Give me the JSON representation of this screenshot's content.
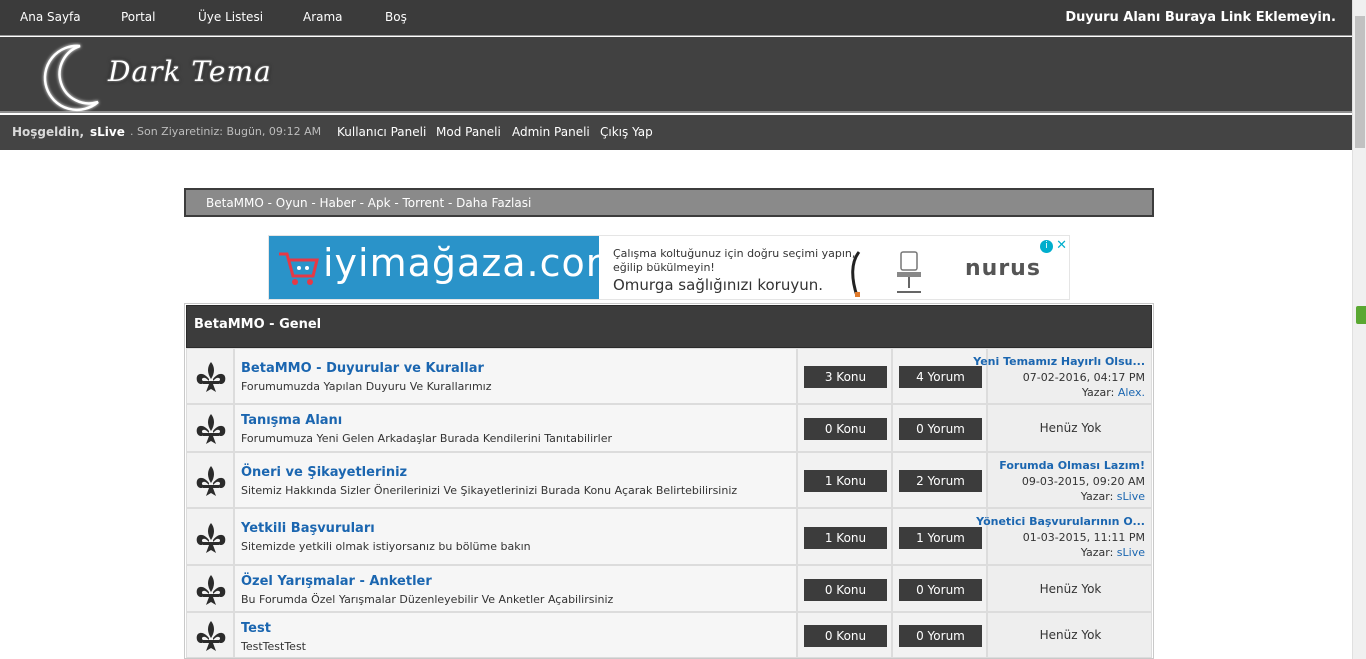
{
  "topnav": {
    "items": [
      "Ana Sayfa",
      "Portal",
      "Üye Listesi",
      "Arama",
      "Boş"
    ],
    "announcement": "Duyuru Alanı Buraya Link Eklemeyin."
  },
  "header": {
    "logo_text": "Dark Tema"
  },
  "userbar": {
    "greeting": "Hoşgeldin,",
    "username": "sLive",
    "last_visit": ". Son Ziyaretiniz: Bugün, 09:12 AM",
    "links": [
      "Kullanıcı Paneli",
      "Mod Paneli",
      "Admin Paneli",
      "Çıkış Yap"
    ]
  },
  "breadcrumb": "BetaMMO - Oyun - Haber - Apk - Torrent - Daha Fazlasi",
  "ad": {
    "brand": "iyimağaza.com",
    "line1": "Çalışma koltuğunuz için doğru seçimi yapın,",
    "line2": "eğilip bükülmeyin!",
    "line3": "Omurga sağlığınızı koruyun.",
    "sponsor": "nurus",
    "info_icon": "i",
    "close_icon": "✕"
  },
  "category": {
    "title": "BetaMMO - Genel"
  },
  "forums": [
    {
      "title": "BetaMMO - Duyurular ve Kurallar",
      "desc": "Forumumuzda Yapılan Duyuru Ve Kurallarımız",
      "topics": "3 Konu",
      "posts": "4 Yorum",
      "last": {
        "title": "Yeni Temamız Hayırlı Olsu...",
        "date": "07-02-2016, 04:17 PM",
        "author_label": "Yazar:",
        "author": "Alex."
      }
    },
    {
      "title": "Tanışma Alanı",
      "desc": "Forumumuza Yeni Gelen Arkadaşlar Burada Kendilerini Tanıtabilirler",
      "topics": "0 Konu",
      "posts": "0 Yorum",
      "last": {
        "none": "Henüz Yok"
      }
    },
    {
      "title": "Öneri ve Şikayetleriniz",
      "desc": "Sitemiz Hakkında Sizler Önerilerinizi Ve Şikayetlerinizi Burada Konu Açarak Belirtebilirsiniz",
      "topics": "1 Konu",
      "posts": "2 Yorum",
      "last": {
        "title": "Forumda Olması Lazım!",
        "date": "09-03-2015, 09:20 AM",
        "author_label": "Yazar:",
        "author": "sLive"
      }
    },
    {
      "title": "Yetkili Başvuruları",
      "desc": "Sitemizde yetkili olmak istiyorsanız bu bölüme bakın",
      "topics": "1 Konu",
      "posts": "1 Yorum",
      "last": {
        "title": "Yönetici Başvurularının O...",
        "date": "01-03-2015, 11:11 PM",
        "author_label": "Yazar:",
        "author": "sLive"
      }
    },
    {
      "title": "Özel Yarışmalar - Anketler",
      "desc": "Bu Forumda Özel Yarışmalar Düzenleyebilir Ve Anketler Açabilirsiniz",
      "topics": "0 Konu",
      "posts": "0 Yorum",
      "last": {
        "none": "Henüz Yok"
      }
    },
    {
      "title": "Test",
      "desc": "TestTestTest",
      "topics": "0 Konu",
      "posts": "0 Yorum",
      "last": {
        "none": "Henüz Yok"
      }
    }
  ]
}
